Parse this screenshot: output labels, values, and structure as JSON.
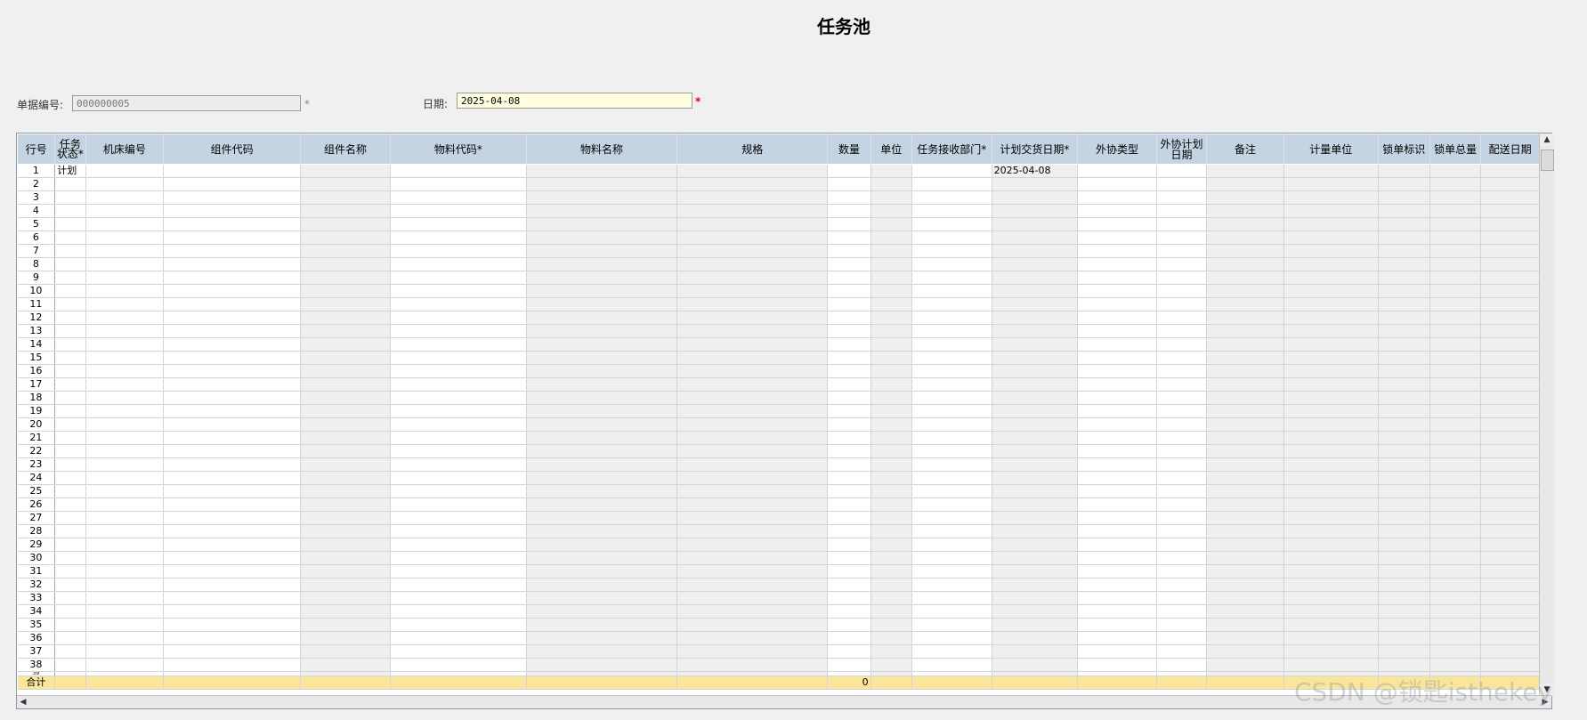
{
  "page_title": "任务池",
  "form": {
    "doc_no_label": "单据编号:",
    "doc_no_value": "000000005",
    "doc_no_required": "*",
    "date_label": "日期:",
    "date_value": "2025-04-08",
    "date_required": "*"
  },
  "grid": {
    "columns": [
      "行号",
      "任务状态*",
      "机床编号",
      "组件代码",
      "组件名称",
      "物料代码*",
      "物料名称",
      "规格",
      "数量",
      "单位",
      "任务接收部门*",
      "计划交货日期*",
      "外协类型",
      "外协计划日期",
      "备注",
      "计量单位",
      "锁单标识",
      "锁单总量",
      "配送日期"
    ],
    "row1": {
      "status": "计划",
      "planned_delivery_date": "2025-04-08"
    },
    "total_label": "合计",
    "total_quantity": "0"
  },
  "watermark": "CSDN @锁匙isthekey"
}
